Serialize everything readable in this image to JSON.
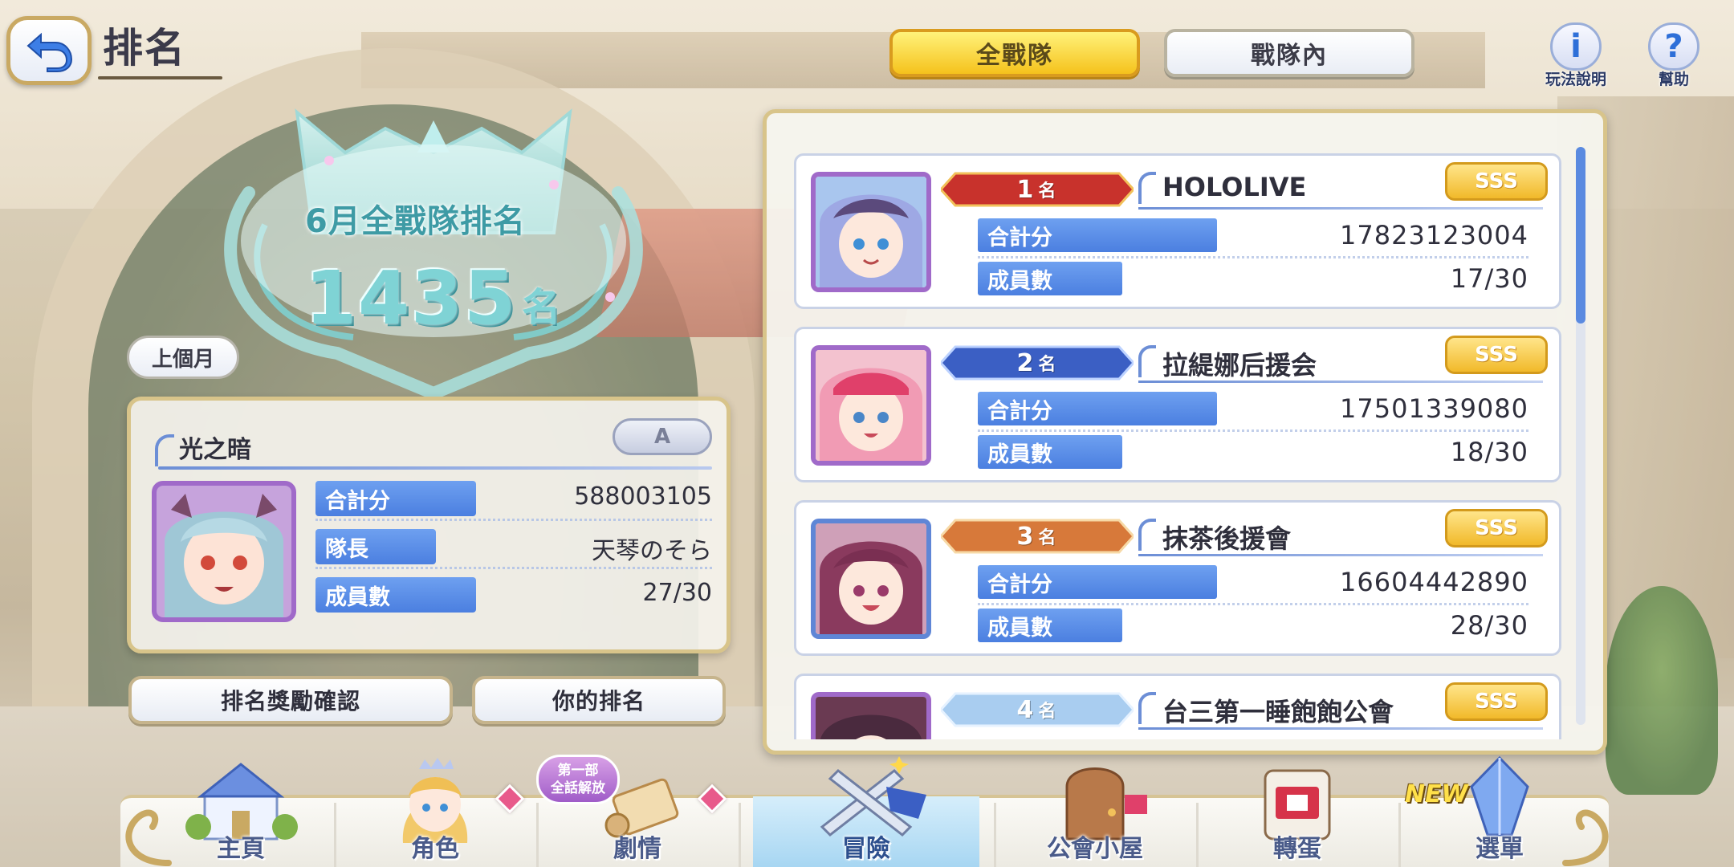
{
  "header": {
    "back_label": "back",
    "title": "排名"
  },
  "tabs": [
    {
      "label": "全戰隊",
      "active": true
    },
    {
      "label": "戰隊內",
      "active": false
    }
  ],
  "help": {
    "info_label": "玩法說明",
    "info_icon": "i",
    "help_label": "幫助",
    "help_icon": "?"
  },
  "summary": {
    "month_title": "6月全戰隊排名",
    "rank_number": "1435",
    "rank_unit": "名",
    "prev_month_button": "上個月"
  },
  "clan": {
    "name": "光之暗",
    "grade": "A",
    "stats": [
      {
        "label": "合計分",
        "value": "588003105"
      },
      {
        "label": "隊長",
        "value": "天琴のそら"
      },
      {
        "label": "成員數",
        "value": "27/30"
      }
    ]
  },
  "buttons": {
    "reward_check": "排名獎勵確認",
    "your_rank": "你的排名"
  },
  "rankings": [
    {
      "rank": "1",
      "unit": "名",
      "name": "HOLOLIVE",
      "grade": "SSS",
      "total_label": "合計分",
      "total": "17823123004",
      "members_label": "成員數",
      "members": "17/30",
      "ribbon_color": "#c8322c"
    },
    {
      "rank": "2",
      "unit": "名",
      "name": "拉緹娜后援会",
      "grade": "SSS",
      "total_label": "合計分",
      "total": "17501339080",
      "members_label": "成員數",
      "members": "18/30",
      "ribbon_color": "#3b5fc4"
    },
    {
      "rank": "3",
      "unit": "名",
      "name": "抹茶後援會",
      "grade": "SSS",
      "total_label": "合計分",
      "total": "16604442890",
      "members_label": "成員數",
      "members": "28/30",
      "ribbon_color": "#d7793a"
    },
    {
      "rank": "4",
      "unit": "名",
      "name": "台三第一睡飽飽公會",
      "grade": "SSS",
      "ribbon_color": "#a9cdf0"
    }
  ],
  "nav": {
    "items": [
      {
        "label": "主頁",
        "icon": "castle-icon"
      },
      {
        "label": "角色",
        "icon": "character-icon"
      },
      {
        "label": "劇情",
        "icon": "scroll-icon"
      },
      {
        "label": "冒險",
        "icon": "crossed-swords-icon",
        "active": true
      },
      {
        "label": "公會小屋",
        "icon": "house-door-icon"
      },
      {
        "label": "轉蛋",
        "icon": "gacha-icon"
      },
      {
        "label": "選單",
        "icon": "crystal-icon"
      }
    ],
    "story_badge_line1": "第一部",
    "story_badge_line2": "全話解放",
    "new_badge": "NEW"
  }
}
